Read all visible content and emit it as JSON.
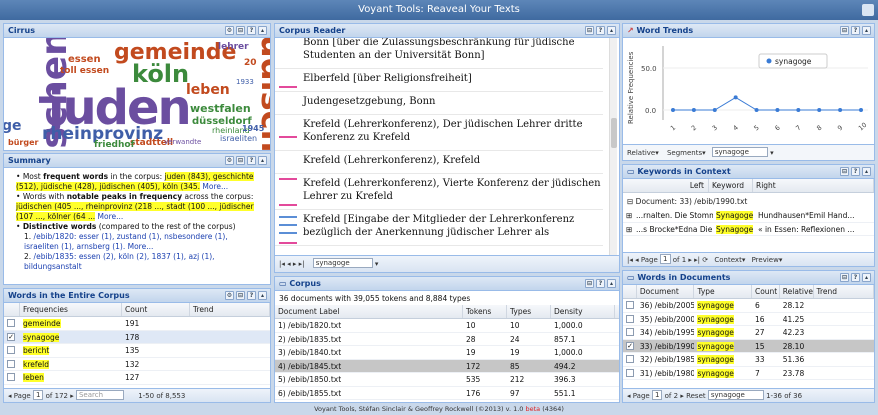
{
  "app": {
    "title": "Voyant Tools: Reaveal Your Texts"
  },
  "cirrus": {
    "title": "Cirrus",
    "words": [
      {
        "text": "juden",
        "color": "#6b4ea0"
      },
      {
        "text": "dischen",
        "color": "#6b4ea0"
      },
      {
        "text": "jüdische",
        "color": "#c24a1e"
      },
      {
        "text": "gemeinde",
        "color": "#c24a1e"
      },
      {
        "text": "köln",
        "color": "#3c8a3c"
      },
      {
        "text": "rheinprovinz",
        "color": "#3f5ea8"
      },
      {
        "text": "westfalen",
        "color": "#3c8a3c"
      },
      {
        "text": "leben",
        "color": "#c24a1e"
      },
      {
        "text": "düsseldorf",
        "color": "#3c8a3c"
      },
      {
        "text": "lehrer",
        "color": "#6b4ea0"
      },
      {
        "text": "israeliten",
        "color": "#3f5ea8"
      },
      {
        "text": "stadttell",
        "color": "#c24a1e"
      },
      {
        "text": "friedhof",
        "color": "#3c8a3c"
      },
      {
        "text": "essen",
        "color": "#c24a1e"
      },
      {
        "text": "toll essen",
        "color": "#c24a1e"
      },
      {
        "text": "rheinland",
        "color": "#3c8a3c"
      },
      {
        "text": "bürger",
        "color": "#c24a1e"
      },
      {
        "text": "verwandte",
        "color": "#6b4ea0"
      },
      {
        "text": "1945",
        "color": "#3f5ea8"
      },
      {
        "text": "1933",
        "color": "#3f5ea8"
      },
      {
        "text": "20",
        "color": "#c24a1e"
      },
      {
        "text": "ge",
        "color": "#3f5ea8"
      }
    ]
  },
  "summary": {
    "title": "Summary",
    "line1_pre": "Most ",
    "line1_bold": "frequent words",
    "line1_mid": " in the corpus: ",
    "line1_words": "juden (843), geschichte (512), jüdische (428), jüdischen (405), köln (345.",
    "line1_more": "More...",
    "line2_pre": "Words with ",
    "line2_bold": "notable peaks in frequency",
    "line2_mid": " across the corpus:",
    "line2_words": "jüdischen (405 ..., rheinprovinz (218 ..., stadt (100 ..., jüdischer (107 ..., kölner (64 ...",
    "line2_more": "More...",
    "line3_bold": "Distinctive words",
    "line3_rest": " (compared to the rest of the corpus)",
    "items": [
      "/ebib/1820: esser (1), zustand (1), nsbesondere (1), israeliten (1), arnsberg (1). More...",
      "/ebib/1835: essen (2), köln (2), 1837 (1), azj (1), bildungsanstalt"
    ]
  },
  "words_corpus": {
    "title": "Words in the Entire Corpus",
    "columns": [
      "Frequencies",
      "Count",
      "Trend"
    ],
    "rows": [
      {
        "word": "gemeinde",
        "count": "191",
        "checked": false
      },
      {
        "word": "synagoge",
        "count": "178",
        "checked": true
      },
      {
        "word": "bericht",
        "count": "135",
        "checked": false
      },
      {
        "word": "krefeld",
        "count": "132",
        "checked": false
      },
      {
        "word": "leben",
        "count": "127",
        "checked": false
      }
    ],
    "pager": {
      "page_label": "Page",
      "page": "1",
      "of": "of 172",
      "search": "Search",
      "range": "1-50 of 8,553"
    }
  },
  "reader": {
    "title": "Corpus Reader",
    "items": [
      "Bonn [über die Zulassungsbeschränkung für jüdische Studenten an der Universität Bonn]",
      "Elberfeld [über Religionsfreiheit]",
      "Judengesetzgebung, Bonn",
      "Krefeld (Lehrerkonferenz), Der jüdischen Lehrer dritte Konferenz zu Krefeld",
      "Krefeld (Lehrerkonferenz), Krefeld",
      "Krefeld (Lehrerkonferenz), Vierte Konferenz der jüdischen Lehrer zu Krefeld",
      "Krefeld [Eingabe der Mitglieder der Lehrerkonferenz bezüglich der Anerkennung jüdischer Lehrer als"
    ],
    "search_value": "synagoge"
  },
  "corpus": {
    "title": "Corpus",
    "summary": "36 documents with 39,055 tokens and 8,884 types",
    "columns": [
      "Document Label",
      "Tokens",
      "Types",
      "Density"
    ],
    "rows": [
      [
        "1) /ebib/1820.txt",
        "10",
        "10",
        "1,000.0"
      ],
      [
        "2) /ebib/1835.txt",
        "28",
        "24",
        "857.1"
      ],
      [
        "3) /ebib/1840.txt",
        "19",
        "19",
        "1,000.0"
      ],
      [
        "4) /ebib/1845.txt",
        "172",
        "85",
        "494.2"
      ],
      [
        "5) /ebib/1850.txt",
        "535",
        "212",
        "396.3"
      ],
      [
        "6) /ebib/1855.txt",
        "176",
        "97",
        "551.1"
      ]
    ]
  },
  "trends": {
    "title": "Word Trends",
    "ylabel": "Relative Frequencies",
    "legend": "synagoge",
    "yticks": [
      "50.0",
      "0.0"
    ],
    "xticks": [
      "1",
      "2",
      "3",
      "4",
      "5",
      "6",
      "7",
      "8",
      "9",
      "10"
    ],
    "series": [
      {
        "name": "synagoge",
        "values": [
          0,
          0,
          0,
          15,
          0,
          0,
          0,
          0,
          0,
          0
        ]
      }
    ],
    "toolbar": {
      "relative": "Relative",
      "segments": "Segments",
      "value": "synagoge"
    }
  },
  "kwic": {
    "title": "Keywords in Context",
    "columns": [
      "Left",
      "Keyword",
      "Right"
    ],
    "group": "Document: 33) /ebib/1990.txt",
    "rows": [
      {
        "left": "...rnalten. Die Stommelner",
        "kw": "Synagoge",
        "right": "Hundhausen*Emil Hand..."
      },
      {
        "left": "...s Brocke*Edna Die »Alte",
        "kw": "Synagoge",
        "right": "« in Essen: Reflexionen ..."
      }
    ],
    "pager": {
      "page_label": "Page",
      "page": "1",
      "of": "of 1",
      "context": "Context",
      "preview": "Preview"
    }
  },
  "docs": {
    "title": "Words in Documents",
    "columns": [
      "Document",
      "Type",
      "Count",
      "Relative",
      "Trend"
    ],
    "rows": [
      {
        "doc": "36) /ebib/2005",
        "type": "synagoge",
        "count": "6",
        "rel": "28.12",
        "checked": false
      },
      {
        "doc": "35) /ebib/2000",
        "type": "synagoge",
        "count": "16",
        "rel": "41.25",
        "checked": false
      },
      {
        "doc": "34) /ebib/1995",
        "type": "synagoge",
        "count": "27",
        "rel": "42.23",
        "checked": false
      },
      {
        "doc": "33) /ebib/1990",
        "type": "synagoge",
        "count": "15",
        "rel": "28.10",
        "checked": true
      },
      {
        "doc": "32) /ebib/1985",
        "type": "synagoge",
        "count": "33",
        "rel": "51.36",
        "checked": false
      },
      {
        "doc": "31) /ebib/1980",
        "type": "synagoge",
        "count": "7",
        "rel": "23.78",
        "checked": false
      }
    ],
    "pager": {
      "page_label": "Page",
      "page": "1",
      "of": "of 2",
      "reset": "Reset",
      "search": "synagoge",
      "range": "1-36 of 36"
    }
  },
  "footer": {
    "text": "Voyant Tools, Stéfan Sinclair & Geoffrey Rockwell (©2013) v. 1.0",
    "beta": "beta",
    "build": "(4364)"
  }
}
